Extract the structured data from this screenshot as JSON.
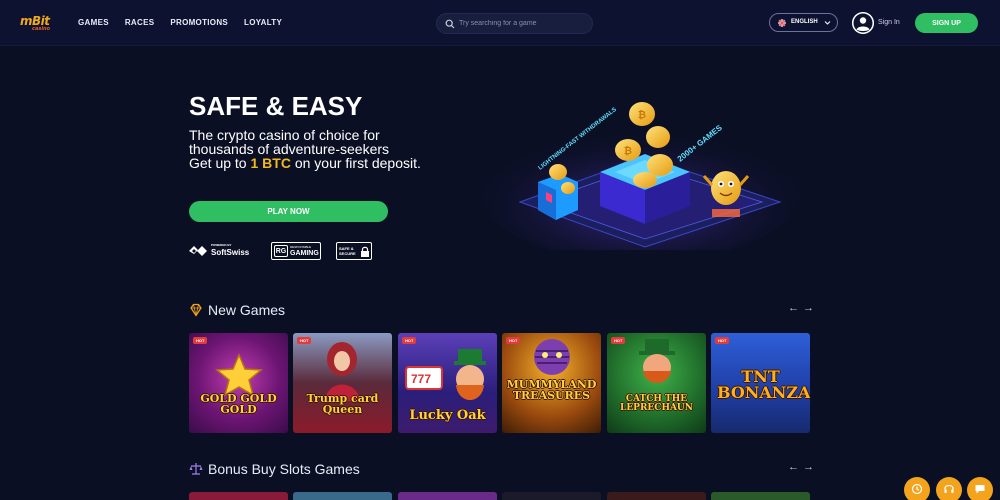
{
  "header": {
    "logo": "mBit",
    "logo_sub": "casino",
    "nav": [
      "GAMES",
      "RACES",
      "PROMOTIONS",
      "LOYALTY"
    ],
    "search_placeholder": "Try searching for a game",
    "language": "ENGLISH",
    "signin": "Sign In",
    "signup": "SIGN UP"
  },
  "hero": {
    "title": "SAFE & EASY",
    "line1": "The crypto casino of choice for thousands of adventure-seekers",
    "line2_pre": "Get up to ",
    "line2_highlight": "1 BTC",
    "line2_post": " on your first deposit.",
    "play_button": "PLAY NOW",
    "art_text_left": "LIGHTNING-FAST WITHDRAWALS",
    "art_text_right": "2000+ GAMES"
  },
  "badges": {
    "softswiss_small": "POWERED BY",
    "softswiss_big": "SoftSwiss",
    "rg_small": "RESPONSIBLE",
    "rg_big": "GAMING",
    "rg_logo": "RG",
    "safe": "SAFE & SECURE"
  },
  "sections": {
    "new_games": "New Games",
    "bonus_buy": "Bonus Buy Slots Games",
    "prev": "←",
    "next": "→"
  },
  "games": [
    {
      "badge": "HOT",
      "name": "GOLD GOLD GOLD"
    },
    {
      "badge": "HOT",
      "name": "Trump card Queen"
    },
    {
      "badge": "HOT",
      "name": "Lucky Oak"
    },
    {
      "badge": "HOT",
      "name": "MUMMYLAND TREASURES"
    },
    {
      "badge": "HOT",
      "name": "CATCH THE LEPRECHAUN"
    },
    {
      "badge": "HOT",
      "name": "TNT BONANZA"
    }
  ],
  "colors": {
    "background": "#0b0f24",
    "header": "#0d1230",
    "accent_green": "#2fbf62",
    "highlight_gold": "#f3b81c",
    "hot_badge": "#e23b3b",
    "float_button": "#f3a31c"
  }
}
